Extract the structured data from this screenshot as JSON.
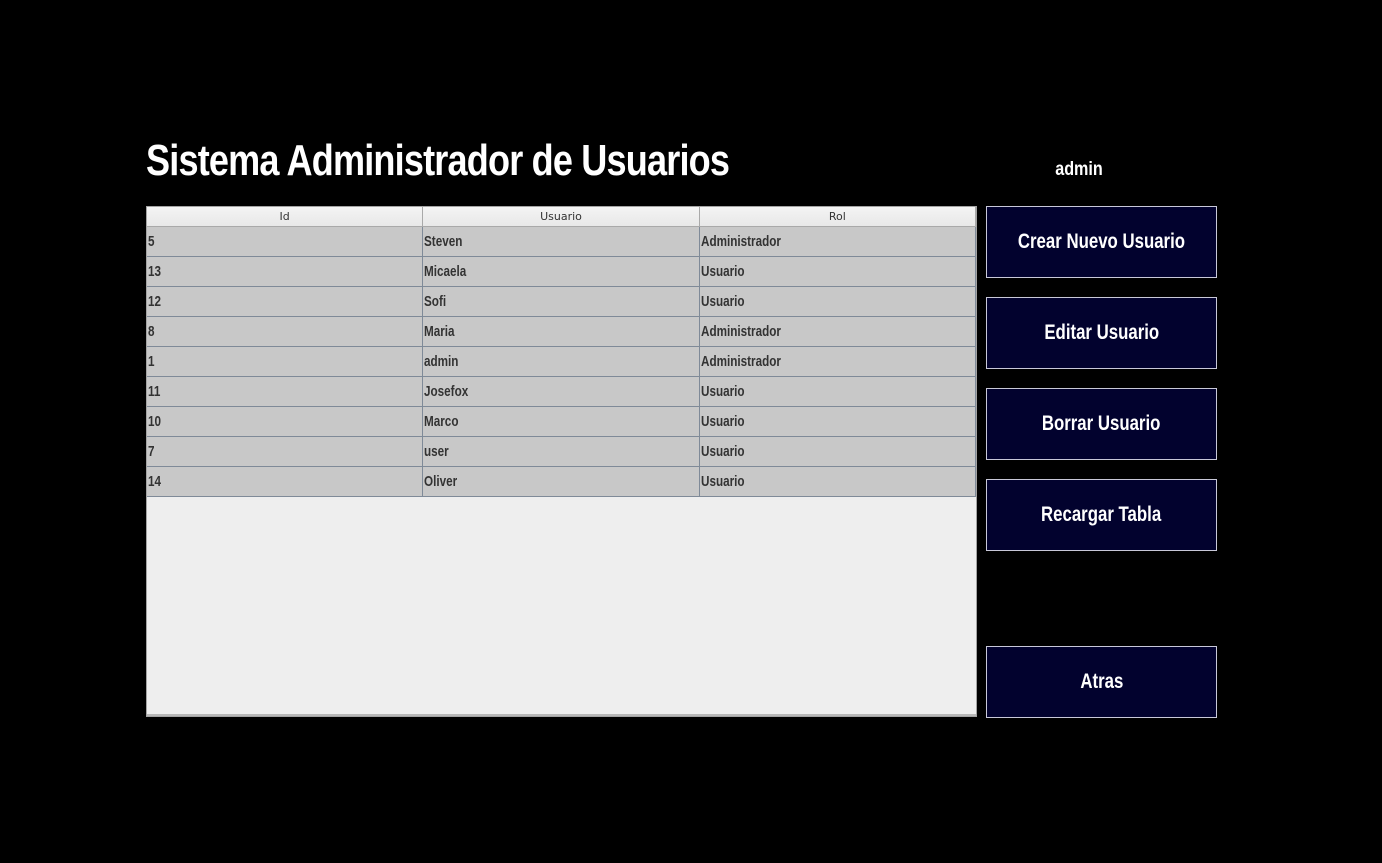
{
  "header": {
    "title": "Sistema Administrador de Usuarios",
    "current_user": "admin"
  },
  "table": {
    "columns": [
      "Id",
      "Usuario",
      "Rol"
    ],
    "rows": [
      [
        "5",
        "Steven",
        "Administrador"
      ],
      [
        "13",
        "Micaela",
        "Usuario"
      ],
      [
        "12",
        "Sofi",
        "Usuario"
      ],
      [
        "8",
        "Maria",
        "Administrador"
      ],
      [
        "1",
        "admin",
        "Administrador"
      ],
      [
        "11",
        "Josefox",
        "Usuario"
      ],
      [
        "10",
        "Marco",
        "Usuario"
      ],
      [
        "7",
        "user",
        "Usuario"
      ],
      [
        "14",
        "Oliver",
        "Usuario"
      ]
    ]
  },
  "actions": {
    "create_label": "Crear Nuevo Usuario",
    "edit_label": "Editar Usuario",
    "delete_label": "Borrar Usuario",
    "reload_label": "Recargar Tabla",
    "back_label": "Atras"
  },
  "colors": {
    "background": "#000000",
    "button_background": "#02022e",
    "row_background": "#c8c8c8",
    "table_background": "#eeeeee"
  }
}
